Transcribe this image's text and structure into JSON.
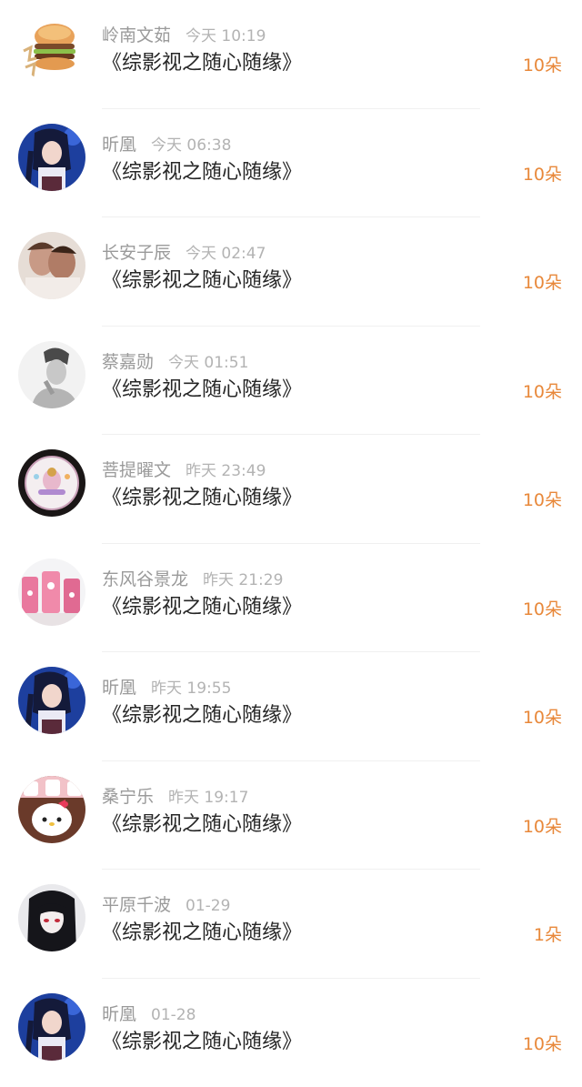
{
  "items": [
    {
      "name": "岭南文茹",
      "time": "今天 10:19",
      "title": "《综影视之随心随缘》",
      "flowers": "10朵",
      "avatar": "burger-avatar"
    },
    {
      "name": "昕凰",
      "time": "今天 06:38",
      "title": "《综影视之随心随缘》",
      "flowers": "10朵",
      "avatar": "anime-girl-blue-avatar"
    },
    {
      "name": "长安子辰",
      "time": "今天 02:47",
      "title": "《综影视之随心随缘》",
      "flowers": "10朵",
      "avatar": "couple-photo-avatar"
    },
    {
      "name": "蔡嘉勋",
      "time": "今天 01:51",
      "title": "《综影视之随心随缘》",
      "flowers": "10朵",
      "avatar": "bw-man-photo-avatar"
    },
    {
      "name": "菩提曜文",
      "time": "昨天 23:49",
      "title": "《综影视之随心随缘》",
      "flowers": "10朵",
      "avatar": "plate-art-avatar"
    },
    {
      "name": "东风谷景龙",
      "time": "昨天 21:29",
      "title": "《综影视之随心随缘》",
      "flowers": "10朵",
      "avatar": "pink-items-avatar"
    },
    {
      "name": "昕凰",
      "time": "昨天 19:55",
      "title": "《综影视之随心随缘》",
      "flowers": "10朵",
      "avatar": "anime-girl-blue-avatar"
    },
    {
      "name": "桑宁乐",
      "time": "昨天 19:17",
      "title": "《综影视之随心随缘》",
      "flowers": "10朵",
      "avatar": "hello-kitty-cups-avatar"
    },
    {
      "name": "平原千波",
      "time": "01-29",
      "title": "《综影视之随心随缘》",
      "flowers": "1朵",
      "avatar": "anime-dark-hair-avatar"
    },
    {
      "name": "昕凰",
      "time": "01-28",
      "title": "《综影视之随心随缘》",
      "flowers": "10朵",
      "avatar": "anime-girl-blue-avatar"
    }
  ],
  "colors": {
    "flowers": "#e8883a",
    "name": "#9a9a9a",
    "time": "#b3b3b3",
    "title": "#262626",
    "divider": "#f0f0f0"
  }
}
